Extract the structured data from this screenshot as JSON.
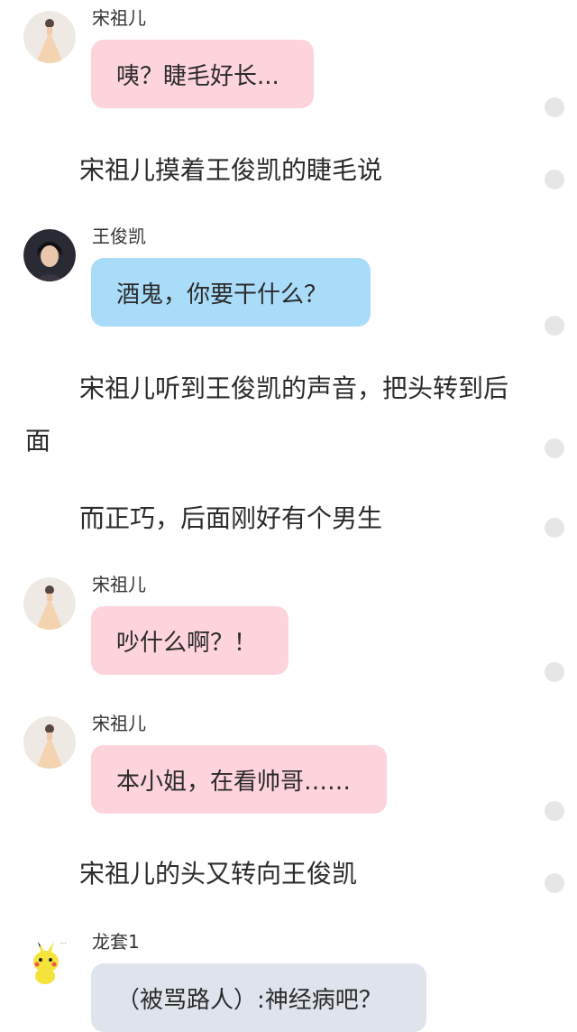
{
  "messages": [
    {
      "kind": "chat",
      "sender": "宋祖儿",
      "text": "咦？睫毛好长...",
      "color": "#fdd3dc",
      "avatar": "song-zuer-avatar"
    },
    {
      "kind": "narration",
      "text": "宋祖儿摸着王俊凯的睫毛说"
    },
    {
      "kind": "chat",
      "sender": "王俊凯",
      "text": "酒鬼，你要干什么？",
      "color": "#a9dcf9",
      "avatar": "wang-junkai-avatar"
    },
    {
      "kind": "narration",
      "text": "宋祖儿听到王俊凯的声音，把头转到后面"
    },
    {
      "kind": "narration",
      "text": "而正巧，后面刚好有个男生"
    },
    {
      "kind": "chat",
      "sender": "宋祖儿",
      "text": "吵什么啊？！",
      "color": "#fdd3dc",
      "avatar": "song-zuer-avatar"
    },
    {
      "kind": "chat",
      "sender": "宋祖儿",
      "text": "本小姐，在看帅哥……",
      "color": "#fdd3dc",
      "avatar": "song-zuer-avatar"
    },
    {
      "kind": "narration",
      "text": "宋祖儿的头又转向王俊凯"
    },
    {
      "kind": "chat",
      "sender": "龙套1",
      "text": "（被骂路人）:神经病吧？",
      "color": "#dfe4ec",
      "avatar": "pikachu-avatar"
    }
  ]
}
